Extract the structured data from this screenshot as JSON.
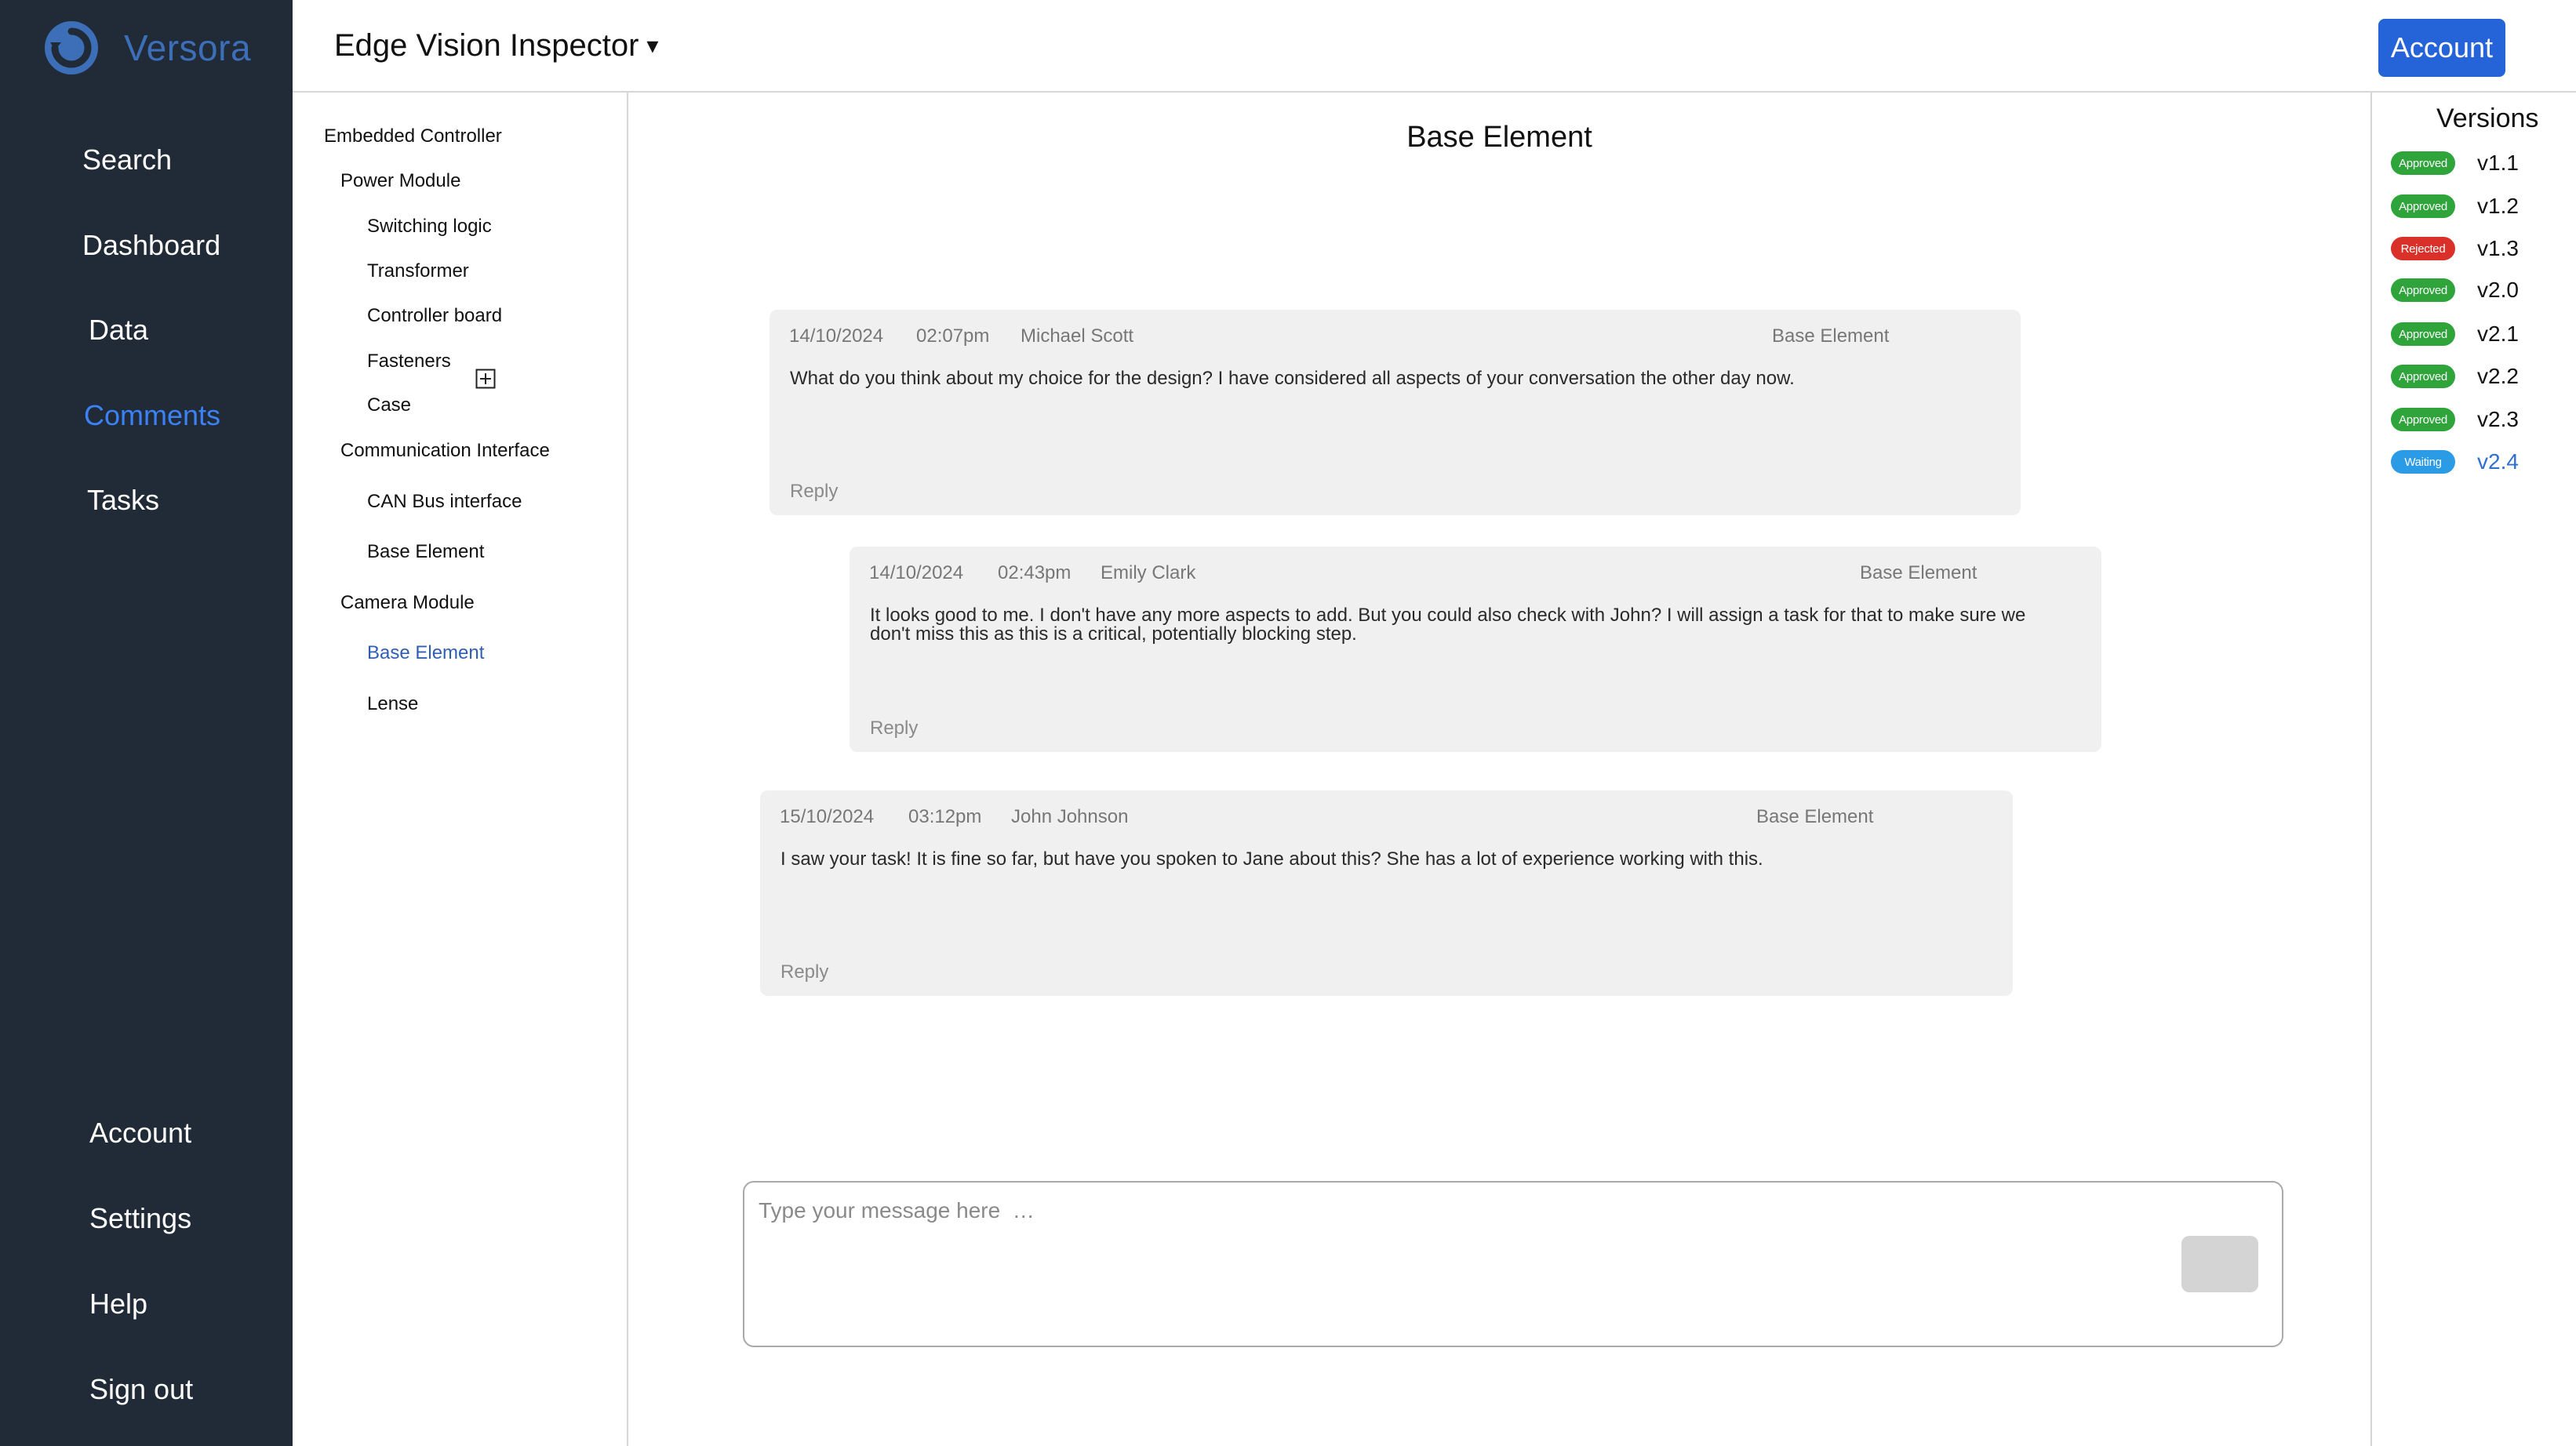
{
  "brand": {
    "name": "Versora",
    "logo_icon": "versora-logo-icon"
  },
  "nav": {
    "top_items": [
      {
        "label": "Search",
        "icon": "search"
      },
      {
        "label": "Dashboard",
        "icon": "dashboard"
      },
      {
        "label": "Data",
        "icon": "data"
      },
      {
        "label": "Comments",
        "icon": "comments",
        "active": true
      },
      {
        "label": "Tasks",
        "icon": "tasks"
      }
    ],
    "bottom_items": [
      {
        "label": "Account"
      },
      {
        "label": "Settings"
      },
      {
        "label": "Help"
      },
      {
        "label": "Sign out"
      }
    ]
  },
  "header": {
    "project_name": "Edge Vision Inspector",
    "project_caret": "▾",
    "account_button": "Account"
  },
  "tree": [
    {
      "label": "Embedded Controller",
      "level": 0
    },
    {
      "label": "Power Module",
      "level": 1
    },
    {
      "label": "Switching logic",
      "level": 2
    },
    {
      "label": "Transformer",
      "level": 2
    },
    {
      "label": "Controller board",
      "level": 2
    },
    {
      "label": "Fasteners",
      "level": 2
    },
    {
      "label": "Case",
      "level": 2
    },
    {
      "label": "Communication Interface",
      "level": 1
    },
    {
      "label": "CAN Bus interface",
      "level": 2
    },
    {
      "label": "Base Element",
      "level": 2
    },
    {
      "label": "Camera Module",
      "level": 1
    },
    {
      "label": "Base Element",
      "level": 2,
      "active": true
    },
    {
      "label": "Lense",
      "level": 2
    }
  ],
  "main": {
    "title": "Base Element",
    "comments": [
      {
        "date": "14/10/2024",
        "time": "02:07pm",
        "author": "Michael Scott",
        "element": "Base Element",
        "text": "What do you think about my choice for the design? I have considered all aspects of your conversation the other day now.",
        "reply_label": "Reply"
      },
      {
        "date": "14/10/2024",
        "time": "02:43pm",
        "author": "Emily Clark",
        "element": "Base Element",
        "text": "It looks good to me. I don't have any more aspects to add. But you could also check with John? I will assign a task for that to make sure we don't miss this as this is a critical, potentially blocking step.",
        "reply_label": "Reply"
      },
      {
        "date": "15/10/2024",
        "time": "03:12pm",
        "author": "John Johnson",
        "element": "Base Element",
        "text": "I saw your task! It is fine so far, but have you spoken to Jane about this? She has a lot of experience working with this.",
        "reply_label": "Reply"
      }
    ],
    "composer": {
      "placeholder": "Type your message here  …",
      "value": ""
    }
  },
  "versions": {
    "title": "Versions",
    "items": [
      {
        "label": "v1.1",
        "status": "Approved"
      },
      {
        "label": "v1.2",
        "status": "Approved"
      },
      {
        "label": "v1.3",
        "status": "Rejected"
      },
      {
        "label": "v2.0",
        "status": "Approved"
      },
      {
        "label": "v2.1",
        "status": "Approved"
      },
      {
        "label": "v2.2",
        "status": "Approved"
      },
      {
        "label": "v2.3",
        "status": "Approved"
      },
      {
        "label": "v2.4",
        "status": "Waiting",
        "current": true
      }
    ]
  },
  "colors": {
    "sidebar_bg": "#212b38",
    "brand": "#3d6fb8",
    "accent": "#2563d8",
    "approved": "#2ea43b",
    "rejected": "#d9302a",
    "waiting": "#2b9be6"
  }
}
